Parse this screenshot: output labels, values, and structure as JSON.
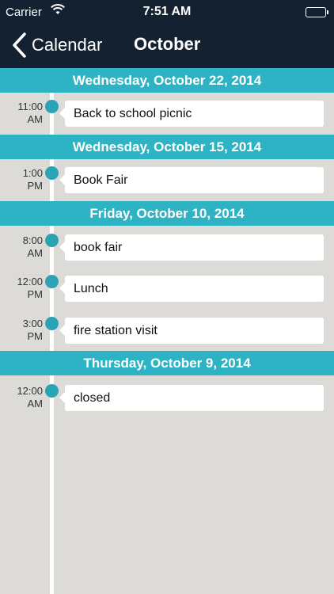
{
  "status_bar": {
    "carrier": "Carrier",
    "time": "7:51 AM",
    "wifi_icon": "wifi-icon",
    "battery_icon": "battery-icon"
  },
  "nav": {
    "back_label": "Calendar",
    "title": "October",
    "back_icon": "chevron-left-icon"
  },
  "colors": {
    "nav_background": "#132131",
    "header_accent": "#2db3c4",
    "dot": "#2ba3b4",
    "page_background": "#dddbd7"
  },
  "days": [
    {
      "header": "Wednesday, October 22, 2014",
      "events": [
        {
          "time_hour": "11:00",
          "time_ampm": "AM",
          "title": "Back to school picnic"
        }
      ]
    },
    {
      "header": "Wednesday, October 15, 2014",
      "events": [
        {
          "time_hour": "1:00",
          "time_ampm": "PM",
          "title": "Book Fair"
        }
      ]
    },
    {
      "header": "Friday, October 10, 2014",
      "events": [
        {
          "time_hour": "8:00",
          "time_ampm": "AM",
          "title": "book fair"
        },
        {
          "time_hour": "12:00",
          "time_ampm": "PM",
          "title": "Lunch"
        },
        {
          "time_hour": "3:00",
          "time_ampm": "PM",
          "title": "fire station visit"
        }
      ]
    },
    {
      "header": "Thursday, October 9, 2014",
      "events": [
        {
          "time_hour": "12:00",
          "time_ampm": "AM",
          "title": "closed"
        }
      ]
    }
  ]
}
